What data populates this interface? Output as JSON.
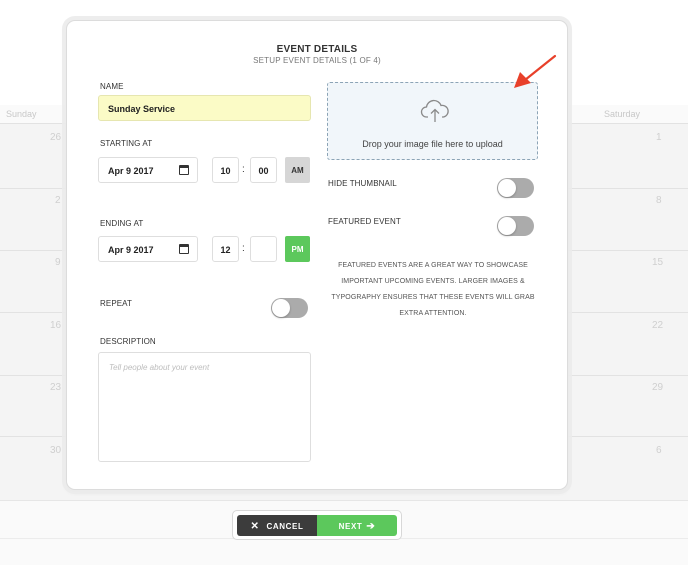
{
  "calendar": {
    "days": [
      "Sunday",
      "Saturday"
    ],
    "left_dates": [
      "26",
      "2",
      "9",
      "16",
      "23",
      "30"
    ],
    "right_dates": [
      "1",
      "8",
      "15",
      "22",
      "29",
      "6"
    ]
  },
  "modal": {
    "title": "EVENT DETAILS",
    "subtitle": "SETUP EVENT DETAILS (1 OF 4)"
  },
  "form": {
    "name_label": "NAME",
    "name_value": "Sunday Service",
    "start_label": "STARTING AT",
    "start_date": "Apr 9 2017",
    "start_hour": "10",
    "start_minute": "00",
    "start_ampm": "AM",
    "end_label": "ENDING AT",
    "end_date": "Apr 9 2017",
    "end_hour": "12",
    "end_minute": "",
    "end_ampm": "PM",
    "repeat_label": "REPEAT",
    "repeat_on": false,
    "description_label": "DESCRIPTION",
    "description_placeholder": "Tell people about your event"
  },
  "upload": {
    "drop_text": "Drop your image file here to upload",
    "icon": "cloud-upload-icon"
  },
  "options": {
    "hide_thumbnail_label": "HIDE THUMBNAIL",
    "hide_thumbnail_on": false,
    "featured_label": "FEATURED EVENT",
    "featured_on": false,
    "featured_info": "FEATURED EVENTS ARE A GREAT WAY TO SHOWCASE IMPORTANT UPCOMING EVENTS. LARGER IMAGES & TYPOGRAPHY ENSURES THAT THESE EVENTS WILL GRAB EXTRA ATTENTION."
  },
  "footer": {
    "cancel_label": "CANCEL",
    "next_label": "NEXT"
  },
  "colors": {
    "accent_green": "#5cc85c",
    "name_highlight": "#fbfbc6",
    "annotation_arrow": "#e8402a"
  }
}
